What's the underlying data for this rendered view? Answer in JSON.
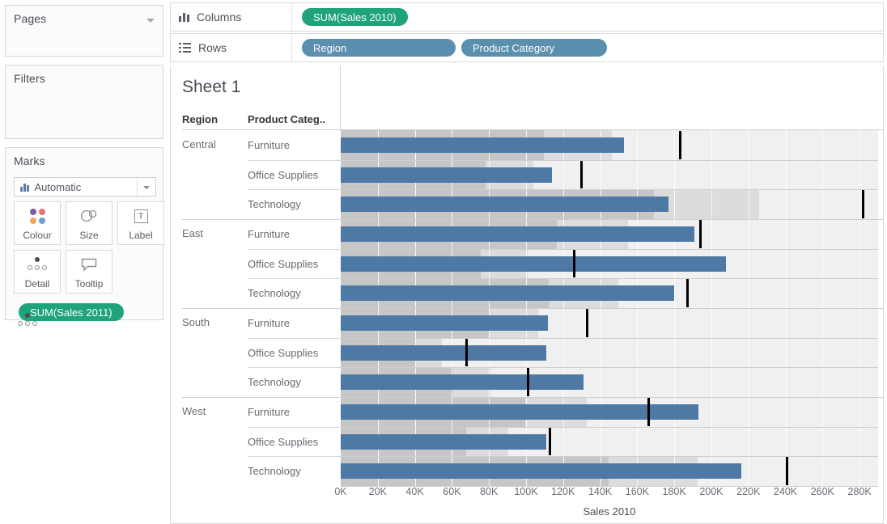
{
  "pages": {
    "title": "Pages",
    "caret": "chevron-down-icon"
  },
  "filters": {
    "title": "Filters"
  },
  "marks": {
    "title": "Marks",
    "mark_type": "Automatic",
    "buttons": [
      {
        "label": "Colour",
        "icon": "colour-dots-icon"
      },
      {
        "label": "Size",
        "icon": "size-circles-icon"
      },
      {
        "label": "Label",
        "icon": "label-text-icon"
      },
      {
        "label": "Detail",
        "icon": "detail-dots-icon"
      },
      {
        "label": "Tooltip",
        "icon": "tooltip-bubble-icon"
      }
    ],
    "pill": "SUM(Sales 2011)",
    "pill_icon": "detail-dots-icon"
  },
  "shelves": {
    "columns": {
      "label": "Columns",
      "icon": "columns-icon",
      "pills": [
        "SUM(Sales 2010)"
      ]
    },
    "rows": {
      "label": "Rows",
      "icon": "rows-icon",
      "pills": [
        "Region",
        "Product Category"
      ]
    }
  },
  "view": {
    "sheet_title": "Sheet 1",
    "header_region": "Region",
    "header_category": "Product Categ.."
  },
  "colors": {
    "pill_green": "#1fa37a",
    "pill_blue": "#5a8fae",
    "bar_blue": "#4f79a5",
    "band_60": "#c6c6c6",
    "band_80": "#dcdcdc",
    "band_bg": "#f0f0f0",
    "reference_line": "#000000"
  },
  "chart_data": {
    "type": "bar",
    "subtype": "bullet-graph",
    "title": "Sheet 1",
    "xlabel": "Sales 2010",
    "ylabel": "",
    "xlim": [
      0,
      290000
    ],
    "grid": true,
    "legend": "none",
    "axis_ticks": [
      "0K",
      "20K",
      "40K",
      "60K",
      "80K",
      "100K",
      "120K",
      "140K",
      "160K",
      "180K",
      "200K",
      "220K",
      "240K",
      "260K",
      "280K"
    ],
    "axis_tick_values": [
      0,
      20000,
      40000,
      60000,
      80000,
      100000,
      120000,
      140000,
      160000,
      180000,
      200000,
      220000,
      240000,
      260000,
      280000
    ],
    "measure_bar": "SUM(Sales 2010)",
    "measure_reference": "SUM(Sales 2011)",
    "reference_bands_pct": [
      60,
      80
    ],
    "groups": [
      "Region",
      "Product Category"
    ],
    "rows": [
      {
        "region": "Central",
        "category": "Furniture",
        "value": 153000,
        "reference": 183000
      },
      {
        "region": "Central",
        "category": "Office Supplies",
        "value": 114000,
        "reference": 130000
      },
      {
        "region": "Central",
        "category": "Technology",
        "value": 177000,
        "reference": 282000
      },
      {
        "region": "East",
        "category": "Furniture",
        "value": 191000,
        "reference": 194000
      },
      {
        "region": "East",
        "category": "Office Supplies",
        "value": 208000,
        "reference": 126000
      },
      {
        "region": "East",
        "category": "Technology",
        "value": 180000,
        "reference": 187000
      },
      {
        "region": "South",
        "category": "Furniture",
        "value": 112000,
        "reference": 133000
      },
      {
        "region": "South",
        "category": "Office Supplies",
        "value": 111000,
        "reference": 68000
      },
      {
        "region": "South",
        "category": "Technology",
        "value": 131000,
        "reference": 101000
      },
      {
        "region": "West",
        "category": "Furniture",
        "value": 193000,
        "reference": 166000
      },
      {
        "region": "West",
        "category": "Office Supplies",
        "value": 111000,
        "reference": 113000
      },
      {
        "region": "West",
        "category": "Technology",
        "value": 216000,
        "reference": 241000
      }
    ]
  }
}
